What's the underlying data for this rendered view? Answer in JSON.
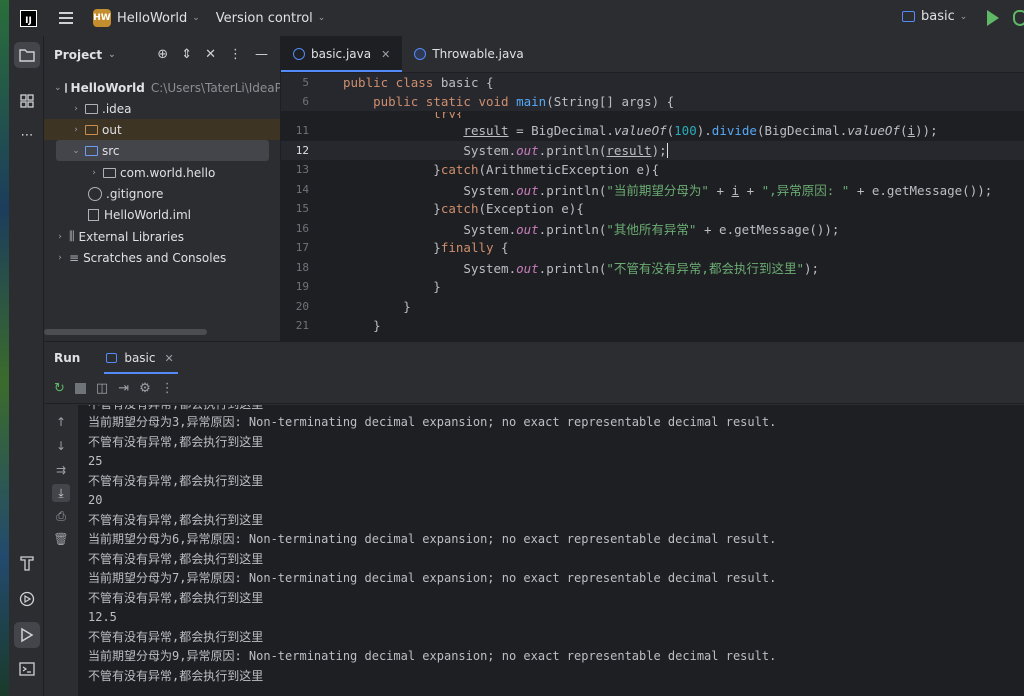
{
  "titlebar": {
    "project_badge": "HW",
    "project_name": "HelloWorld",
    "vcs": "Version control",
    "run_config": "basic"
  },
  "project_panel": {
    "title": "Project",
    "tree": [
      {
        "label": "HelloWorld",
        "path": "C:\\Users\\TaterLi\\IdeaPr"
      },
      {
        "label": ".idea"
      },
      {
        "label": "out"
      },
      {
        "label": "src"
      },
      {
        "label": "com.world.hello"
      },
      {
        "label": ".gitignore"
      },
      {
        "label": "HelloWorld.iml"
      },
      {
        "label": "External Libraries"
      },
      {
        "label": "Scratches and Consoles"
      }
    ]
  },
  "editor": {
    "tabs": [
      {
        "label": "basic.java",
        "active": true
      },
      {
        "label": "Throwable.java",
        "active": false
      }
    ],
    "line_numbers": [
      "5",
      "6",
      "11",
      "12",
      "13",
      "14",
      "15",
      "16",
      "17",
      "18",
      "19",
      "20",
      "21"
    ],
    "current_line": "12"
  },
  "run_panel": {
    "title": "Run",
    "tab": "basic",
    "console_lines": [
      "不管有没有异常,都会执行到这里",
      "当前期望分母为3,异常原因: Non-terminating decimal expansion; no exact representable decimal result.",
      "不管有没有异常,都会执行到这里",
      "25",
      "不管有没有异常,都会执行到这里",
      "20",
      "不管有没有异常,都会执行到这里",
      "当前期望分母为6,异常原因: Non-terminating decimal expansion; no exact representable decimal result.",
      "不管有没有异常,都会执行到这里",
      "当前期望分母为7,异常原因: Non-terminating decimal expansion; no exact representable decimal result.",
      "不管有没有异常,都会执行到这里",
      "12.5",
      "不管有没有异常,都会执行到这里",
      "当前期望分母为9,异常原因: Non-terminating decimal expansion; no exact representable decimal result.",
      "不管有没有异常,都会执行到这里"
    ]
  },
  "colors": {
    "accent": "#548af7",
    "run_green": "#5fb865",
    "badge": "#c48d2e"
  }
}
